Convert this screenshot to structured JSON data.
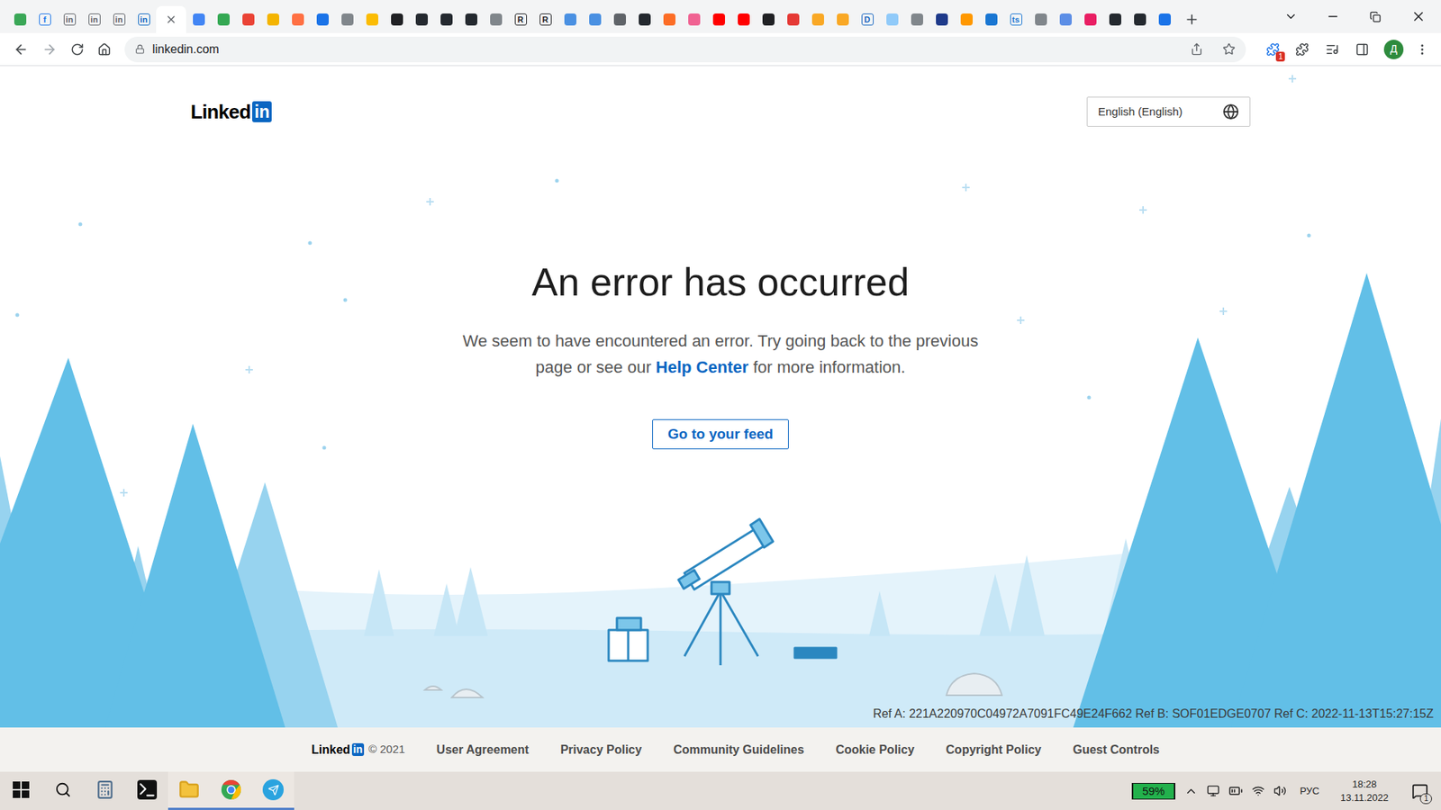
{
  "browser": {
    "tabs": [
      {
        "kind": "dot",
        "color": "#3aa757",
        "selected": false
      },
      {
        "kind": "letter",
        "glyph": "f",
        "color": "#1a73e8",
        "selected": false
      },
      {
        "kind": "letter",
        "glyph": "in",
        "color": "#5f6368",
        "selected": false
      },
      {
        "kind": "letter",
        "glyph": "in",
        "color": "#5f6368",
        "selected": false
      },
      {
        "kind": "letter",
        "glyph": "in",
        "color": "#5f6368",
        "selected": false
      },
      {
        "kind": "letter",
        "glyph": "in",
        "color": "#0a66c2",
        "selected": false
      },
      {
        "kind": "blank",
        "color": "#5f6368",
        "selected": true
      },
      {
        "kind": "dot",
        "color": "#4285f4",
        "selected": false
      },
      {
        "kind": "dot",
        "color": "#34a853",
        "selected": false
      },
      {
        "kind": "dot",
        "color": "#ea4335",
        "selected": false
      },
      {
        "kind": "dot",
        "color": "#f4b400",
        "selected": false
      },
      {
        "kind": "dot",
        "color": "#ff7043",
        "selected": false
      },
      {
        "kind": "dot",
        "color": "#1a73e8",
        "selected": false
      },
      {
        "kind": "dot",
        "color": "#80868b",
        "selected": false
      },
      {
        "kind": "dot",
        "color": "#fbbc04",
        "selected": false
      },
      {
        "kind": "dot",
        "color": "#202124",
        "selected": false
      },
      {
        "kind": "dot",
        "color": "#24292f",
        "selected": false
      },
      {
        "kind": "dot",
        "color": "#24292f",
        "selected": false
      },
      {
        "kind": "dot",
        "color": "#24292f",
        "selected": false
      },
      {
        "kind": "dot",
        "color": "#80868b",
        "selected": false
      },
      {
        "kind": "letter",
        "glyph": "R",
        "color": "#202124",
        "selected": false
      },
      {
        "kind": "letter",
        "glyph": "R",
        "color": "#202124",
        "selected": false
      },
      {
        "kind": "dot",
        "color": "#4a90e2",
        "selected": false
      },
      {
        "kind": "dot",
        "color": "#4a90e2",
        "selected": false
      },
      {
        "kind": "dot",
        "color": "#5f6368",
        "selected": false
      },
      {
        "kind": "dot",
        "color": "#24292f",
        "selected": false
      },
      {
        "kind": "dot",
        "color": "#fc6d26",
        "selected": false
      },
      {
        "kind": "dot",
        "color": "#f06292",
        "selected": false
      },
      {
        "kind": "dot",
        "color": "#ff0000",
        "selected": false
      },
      {
        "kind": "dot",
        "color": "#ff0000",
        "selected": false
      },
      {
        "kind": "dot",
        "color": "#202124",
        "selected": false
      },
      {
        "kind": "dot",
        "color": "#e53935",
        "selected": false
      },
      {
        "kind": "dot",
        "color": "#f9a825",
        "selected": false
      },
      {
        "kind": "dot",
        "color": "#f9a825",
        "selected": false
      },
      {
        "kind": "letter",
        "glyph": "D",
        "color": "#1565c0",
        "selected": false
      },
      {
        "kind": "dot",
        "color": "#90caf9",
        "selected": false
      },
      {
        "kind": "dot",
        "color": "#80868b",
        "selected": false
      },
      {
        "kind": "dot",
        "color": "#1e3a8a",
        "selected": false
      },
      {
        "kind": "dot",
        "color": "#ff9800",
        "selected": false
      },
      {
        "kind": "dot",
        "color": "#1976d2",
        "selected": false
      },
      {
        "kind": "letter",
        "glyph": "ts",
        "color": "#1976d2",
        "selected": false
      },
      {
        "kind": "dot",
        "color": "#80868b",
        "selected": false
      },
      {
        "kind": "dot",
        "color": "#5c8ee6",
        "selected": false
      },
      {
        "kind": "dot",
        "color": "#e91e63",
        "selected": false
      },
      {
        "kind": "dot",
        "color": "#24292f",
        "selected": false
      },
      {
        "kind": "dot",
        "color": "#24292f",
        "selected": false
      },
      {
        "kind": "dot",
        "color": "#1a73e8",
        "selected": false
      }
    ]
  },
  "address_bar": {
    "url": "linkedin.com",
    "extension_badge": "1",
    "profile_initial": "Д"
  },
  "page": {
    "logo": {
      "word": "Linked",
      "mark": "in"
    },
    "language": "English (English)",
    "heading": "An error has occurred",
    "message_before": "We seem to have encountered an error. Try going back to the previous page or see our ",
    "link": "Help Center",
    "message_after": " for more information.",
    "button": "Go to your feed",
    "reference": "Ref A: 221A220970C04972A7091FC49E24F662 Ref B: SOF01EDGE0707 Ref C: 2022-11-13T15:27:15Z"
  },
  "footer": {
    "logo": {
      "word": "Linked",
      "mark": "in"
    },
    "copyright": "© 2021",
    "links": [
      "User Agreement",
      "Privacy Policy",
      "Community Guidelines",
      "Cookie Policy",
      "Copyright Policy",
      "Guest Controls"
    ]
  },
  "taskbar": {
    "apps": [
      {
        "kind": "start",
        "active": false
      },
      {
        "kind": "search",
        "active": false
      },
      {
        "kind": "calculator",
        "active": false
      },
      {
        "kind": "terminal",
        "active": false
      },
      {
        "kind": "explorer",
        "active": true
      },
      {
        "kind": "chrome",
        "active": true
      },
      {
        "kind": "telegram",
        "active": true
      }
    ],
    "battery": "59%",
    "language": "РУС",
    "time": "18:28",
    "date": "13.11.2022",
    "notifications": "1"
  }
}
